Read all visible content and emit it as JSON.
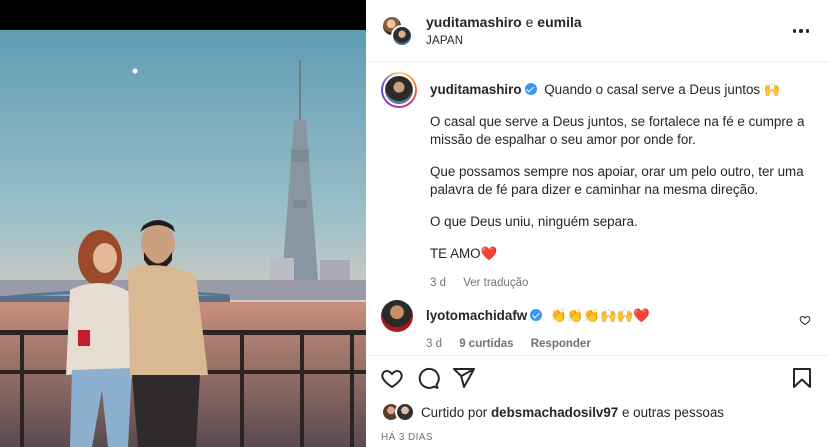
{
  "header": {
    "user1": "yuditamashiro",
    "joiner": "e",
    "user2": "eumila",
    "location": "JAPAN"
  },
  "caption": {
    "username": "yuditamashiro",
    "headline": "Quando o casal serve a Deus juntos 🙌",
    "paragraphs": [
      "O casal que serve a Deus juntos, se fortalece na fé e cumpre a missão de espalhar o seu amor por onde for.",
      "Que possamos sempre nos apoiar, orar um pelo outro, ter uma palavra de fé para dizer e caminhar na mesma direção.",
      "O que Deus uniu, ninguém separa.",
      "TE AMO❤️"
    ],
    "age": "3 d",
    "translate": "Ver tradução"
  },
  "comment": {
    "username": "lyotomachidafw",
    "text": "👏👏👏🙌🙌❤️",
    "age": "3 d",
    "likes": "9 curtidas",
    "reply": "Responder"
  },
  "likes": {
    "prefix": "Curtido por",
    "user": "debsmachadosilv97",
    "suffix": "e outras pessoas"
  },
  "timestamp": "HÁ 3 DIAS",
  "colors": {
    "verified": "#3897f0",
    "heart": "#ed4956",
    "muted": "#737373"
  },
  "icons": [
    "more-icon",
    "verified-icon",
    "heart-icon",
    "comment-icon",
    "share-icon",
    "save-icon"
  ]
}
